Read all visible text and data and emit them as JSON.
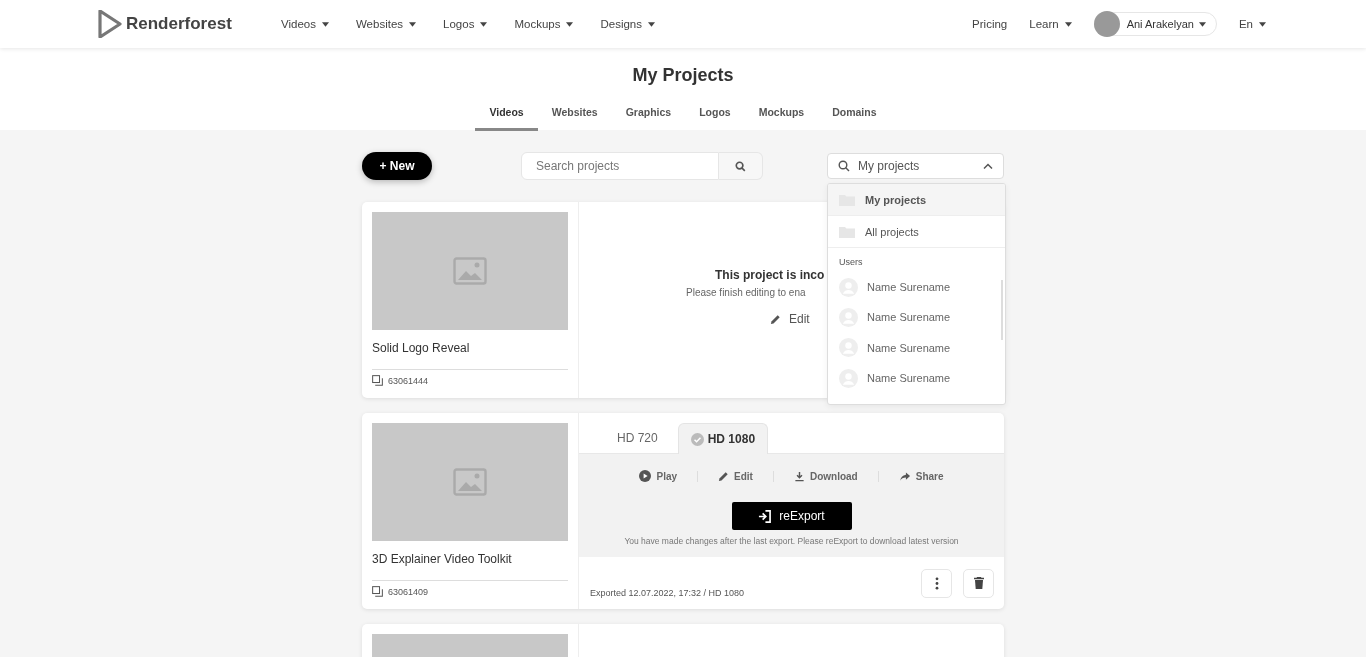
{
  "nav": {
    "logo": "Renderforest",
    "menu": [
      {
        "label": "Videos",
        "dropdown": true
      },
      {
        "label": "Websites",
        "dropdown": true
      },
      {
        "label": "Logos",
        "dropdown": true
      },
      {
        "label": "Mockups",
        "dropdown": true
      },
      {
        "label": "Designs",
        "dropdown": true
      }
    ],
    "links": [
      {
        "label": "Pricing",
        "dropdown": false
      },
      {
        "label": "Learn",
        "dropdown": true
      }
    ],
    "user": {
      "name": "Ani Arakelyan"
    },
    "language": "En"
  },
  "page_title": "My Projects",
  "tabs": [
    {
      "label": "Videos",
      "selected": true
    },
    {
      "label": "Websites",
      "selected": false
    },
    {
      "label": "Graphics",
      "selected": false
    },
    {
      "label": "Logos",
      "selected": false
    },
    {
      "label": "Mockups",
      "selected": false
    },
    {
      "label": "Domains",
      "selected": false
    }
  ],
  "toolbar": {
    "new_button": "+ New",
    "search": {
      "placeholder": "Search projects"
    },
    "filter": {
      "value": "My projects",
      "expanded": true,
      "options": [
        {
          "label": "My projects",
          "selected": true
        },
        {
          "label": "All projects",
          "selected": false
        }
      ],
      "users_heading": "Users",
      "users": [
        "Name Surename",
        "Name Surename",
        "Name Surename",
        "Name Surename"
      ]
    }
  },
  "projects": [
    {
      "kind": "incomplete",
      "title": "Solid Logo Reveal",
      "id": "63061444",
      "message": "This project is inco",
      "hint": "Please finish editing to ena",
      "edit": "Edit"
    },
    {
      "kind": "exported",
      "title": "3D Explainer Video Toolkit",
      "id": "63061409",
      "formats": [
        {
          "label": "HD 720",
          "selected": false
        },
        {
          "label": "HD 1080",
          "selected": true
        }
      ],
      "actions": [
        {
          "kind": "play",
          "label": "Play"
        },
        {
          "kind": "edit",
          "label": "Edit"
        },
        {
          "kind": "download",
          "label": "Download"
        },
        {
          "kind": "share",
          "label": "Share"
        }
      ],
      "reexport": "reExport",
      "note": "You have made changes after the last export. Please reExport to download latest version",
      "exported": "Exported 12.07.2022, 17:32 / HD 1080"
    },
    {
      "kind": "partial"
    }
  ]
}
